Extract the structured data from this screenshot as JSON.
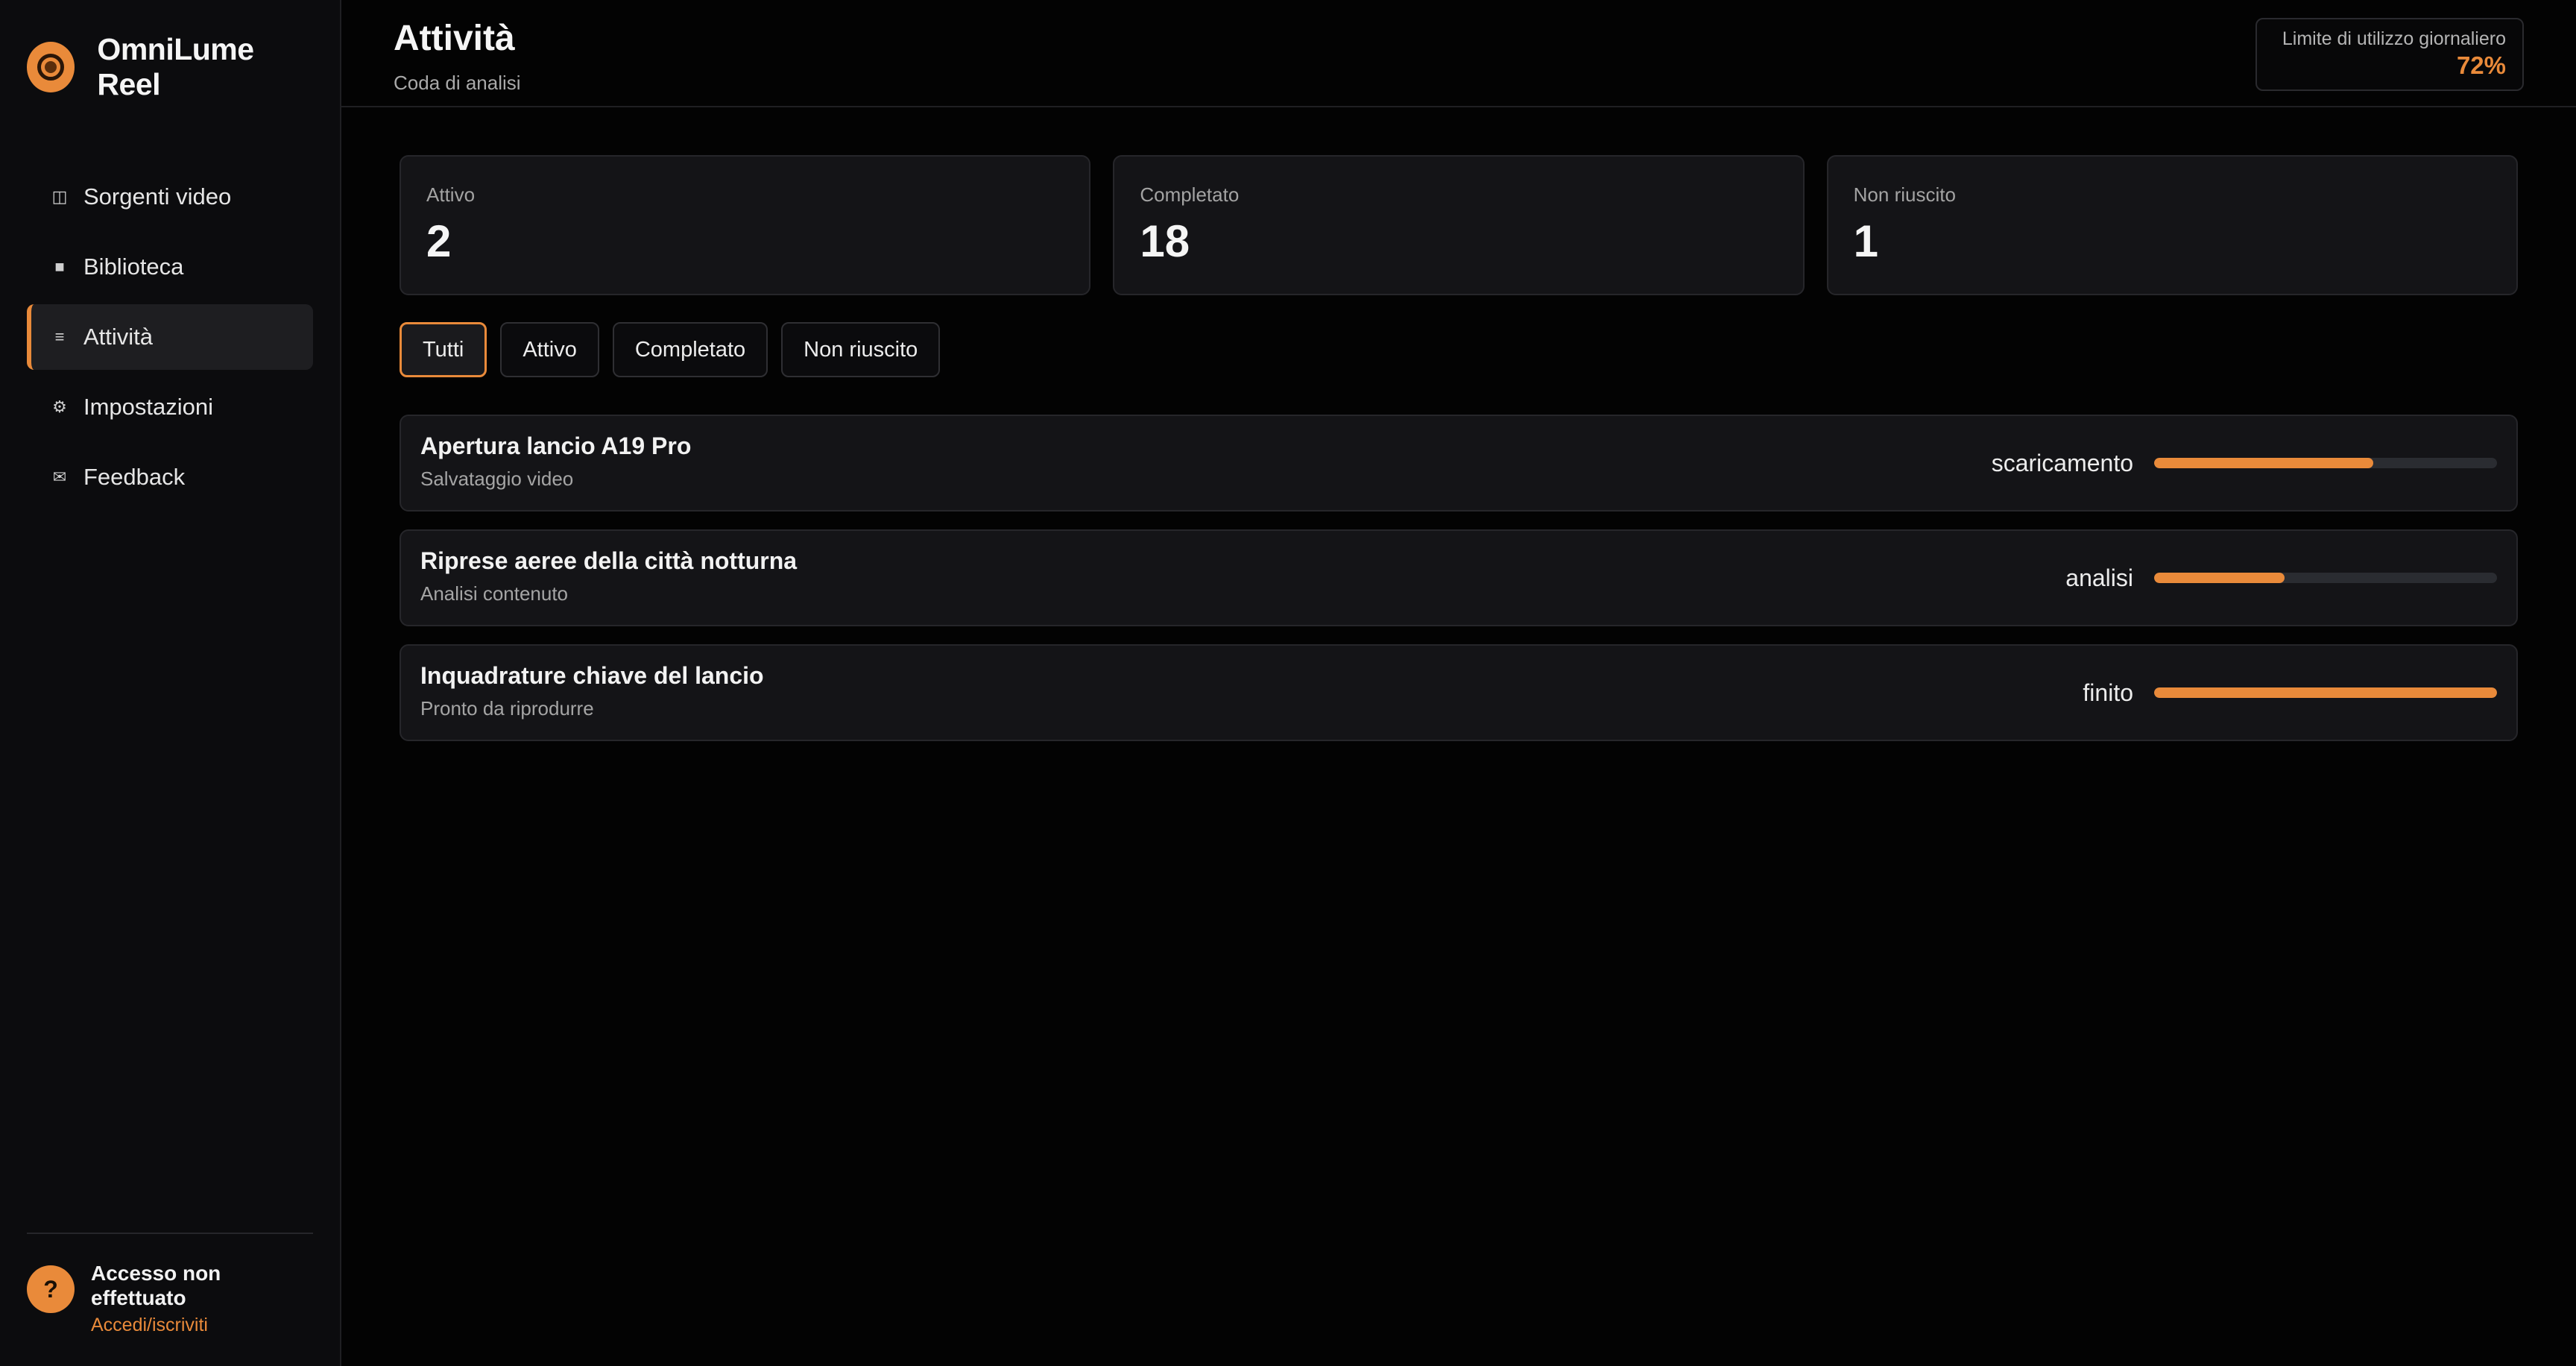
{
  "app": {
    "name": "OmniLume Reel"
  },
  "sidebar": {
    "items": [
      {
        "label": "Sorgenti video",
        "icon": "film-icon",
        "glyph": "◫",
        "active": false
      },
      {
        "label": "Biblioteca",
        "icon": "library-icon",
        "glyph": "■",
        "active": false
      },
      {
        "label": "Attività",
        "icon": "list-icon",
        "glyph": "≡",
        "active": true
      },
      {
        "label": "Impostazioni",
        "icon": "gear-icon",
        "glyph": "⚙",
        "active": false
      },
      {
        "label": "Feedback",
        "icon": "mail-icon",
        "glyph": "✉",
        "active": false
      }
    ],
    "user": {
      "avatar": "?",
      "status": "Accesso non effettuato",
      "login": "Accedi/iscriviti"
    }
  },
  "header": {
    "title": "Attività",
    "subtitle": "Coda di analisi",
    "usage": {
      "label": "Limite di utilizzo giornaliero",
      "value": "72%"
    }
  },
  "stats": [
    {
      "label": "Attivo",
      "value": "2"
    },
    {
      "label": "Completato",
      "value": "18"
    },
    {
      "label": "Non riuscito",
      "value": "1"
    }
  ],
  "filters": [
    {
      "label": "Tutti",
      "active": true
    },
    {
      "label": "Attivo",
      "active": false
    },
    {
      "label": "Completato",
      "active": false
    },
    {
      "label": "Non riuscito",
      "active": false
    }
  ],
  "tasks": [
    {
      "title": "Apertura lancio A19 Pro",
      "subtitle": "Salvataggio video",
      "status": "scaricamento",
      "progress": 0.64
    },
    {
      "title": "Riprese aeree della città notturna",
      "subtitle": "Analisi contenuto",
      "status": "analisi",
      "progress": 0.38
    },
    {
      "title": "Inquadrature chiave del lancio",
      "subtitle": "Pronto da riprodurre",
      "status": "finito",
      "progress": 1.0
    }
  ],
  "colors": {
    "accent": "#e98a3a",
    "background": "#030303",
    "sidebar": "#0c0c0e",
    "card": "#141417"
  }
}
